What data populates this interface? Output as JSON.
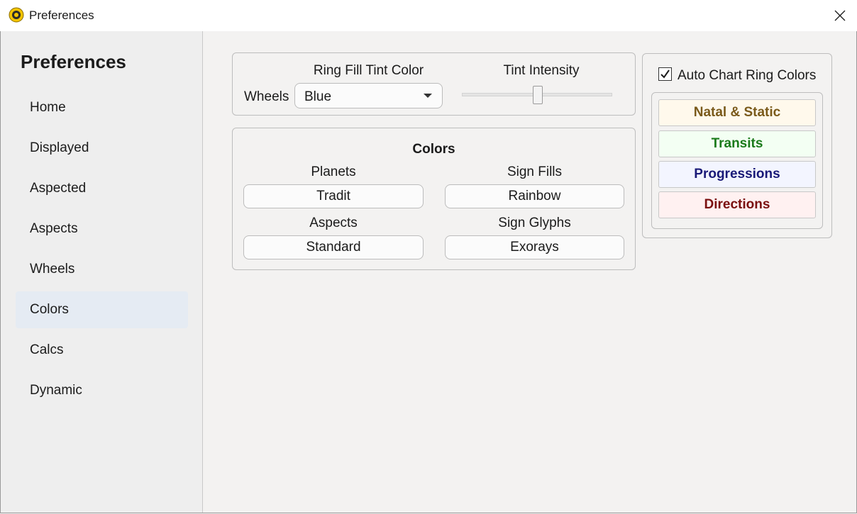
{
  "window": {
    "title": "Preferences"
  },
  "sidebar": {
    "title": "Preferences",
    "items": [
      {
        "label": "Home"
      },
      {
        "label": "Displayed"
      },
      {
        "label": "Aspected"
      },
      {
        "label": "Aspects"
      },
      {
        "label": "Wheels"
      },
      {
        "label": "Colors",
        "selected": true
      },
      {
        "label": "Calcs"
      },
      {
        "label": "Dynamic"
      }
    ]
  },
  "tint_panel": {
    "ring_fill_label": "Ring Fill Tint Color",
    "wheels_label": "Wheels",
    "ring_fill_value": "Blue",
    "intensity_label": "Tint Intensity",
    "intensity_fraction": 0.5
  },
  "colors_panel": {
    "title": "Colors",
    "planets_label": "Planets",
    "planets_value": "Tradit",
    "sign_fills_label": "Sign Fills",
    "sign_fills_value": "Rainbow",
    "aspects_label": "Aspects",
    "aspects_value": "Standard",
    "sign_glyphs_label": "Sign Glyphs",
    "sign_glyphs_value": "Exorays"
  },
  "ring_panel": {
    "auto_label": "Auto Chart Ring Colors",
    "auto_checked": true,
    "buttons": [
      {
        "label": "Natal & Static",
        "text_color": "#7a5a1a",
        "bg": "#fff9ec"
      },
      {
        "label": "Transits",
        "text_color": "#1a7a1a",
        "bg": "#f3fff3"
      },
      {
        "label": "Progressions",
        "text_color": "#1a1a78",
        "bg": "#f3f5ff"
      },
      {
        "label": "Directions",
        "text_color": "#7a1010",
        "bg": "#fff1f1"
      }
    ]
  },
  "icons": {
    "app": "sun-wheel-icon",
    "close": "close-icon",
    "check": "checkmark-icon",
    "caret": "chevron-down-icon"
  }
}
